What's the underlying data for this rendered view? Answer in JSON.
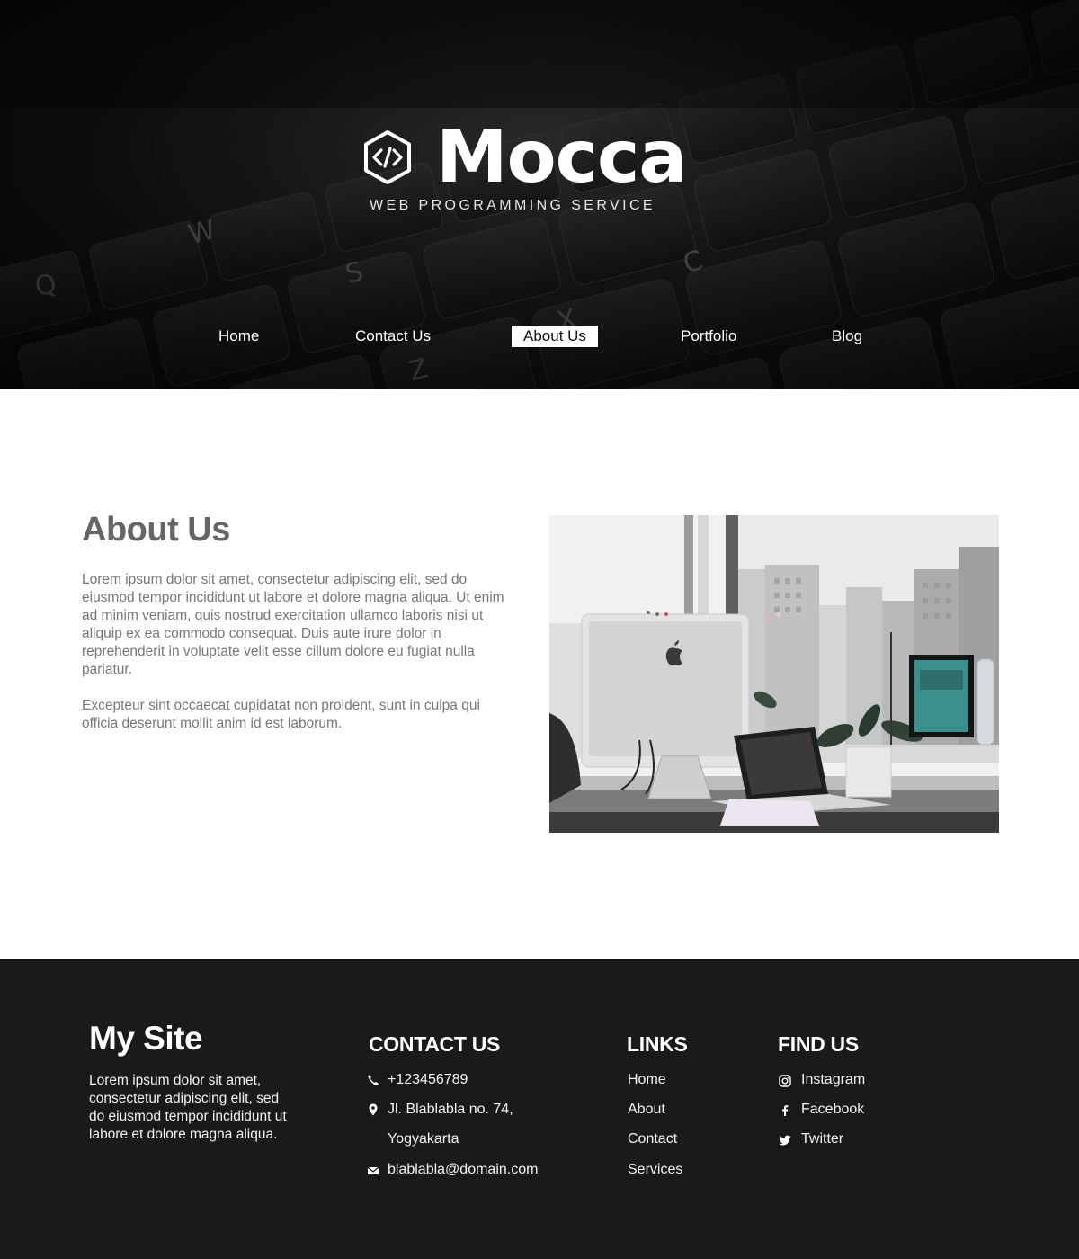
{
  "hero": {
    "brand": "Mocca",
    "tagline": "WEB PROGRAMMING SERVICE",
    "logo_icon": "code-hexagon-icon"
  },
  "nav": {
    "items": [
      {
        "label": "Home",
        "active": false
      },
      {
        "label": "Contact Us",
        "active": false
      },
      {
        "label": "About Us",
        "active": true
      },
      {
        "label": "Portfolio",
        "active": false
      },
      {
        "label": "Blog",
        "active": false
      }
    ]
  },
  "about": {
    "title": "About Us",
    "paragraph1": "Lorem ipsum dolor sit amet, consectetur adipiscing elit, sed do eiusmod tempor incididunt ut labore et dolore magna aliqua. Ut enim ad minim veniam, quis nostrud exercitation ullamco laboris nisi ut aliquip ex ea commodo consequat. Duis aute irure dolor in reprehenderit in voluptate velit esse cillum dolore eu fugiat nulla pariatur.",
    "paragraph2": "Excepteur sint occaecat cupidatat non proident, sunt in culpa qui officia deserunt mollit anim id est laborum.",
    "image_alt": "office-desk-photo"
  },
  "footer": {
    "site_title": "My Site",
    "site_desc": "Lorem ipsum dolor sit amet, consectetur adipiscing elit, sed do eiusmod tempor incididunt ut labore et dolore magna aliqua.",
    "contact": {
      "heading": "CONTACT US",
      "phone": "+123456789",
      "address_line1": "Jl. Blablabla no. 74,",
      "address_line2": "Yogyakarta",
      "email": "blablabla@domain.com"
    },
    "links": {
      "heading": "LINKS",
      "items": [
        "Home",
        "About",
        "Contact",
        "Services"
      ]
    },
    "find_us": {
      "heading": "FIND US",
      "items": [
        "Instagram",
        "Facebook",
        "Twitter"
      ]
    }
  },
  "colors": {
    "footer_bg": "#1a1a1a",
    "heading_gray": "#666666",
    "body_gray": "#777777"
  }
}
